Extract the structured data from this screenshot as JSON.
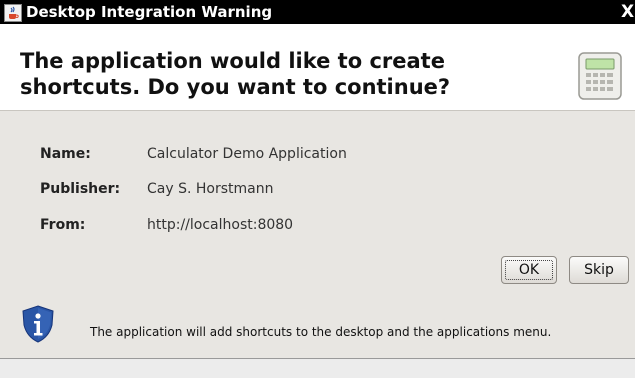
{
  "window": {
    "title": "Desktop Integration Warning",
    "close_glyph": "X"
  },
  "header": {
    "line1": "The application would like to create",
    "line2": "shortcuts. Do you want to continue?",
    "icon": "calculator-icon"
  },
  "details": [
    {
      "label": "Name:",
      "value": "Calculator Demo Application"
    },
    {
      "label": "Publisher:",
      "value": "Cay S. Horstmann"
    },
    {
      "label": "From:",
      "value": "http://localhost:8080"
    }
  ],
  "buttons": {
    "ok": "OK",
    "skip": "Skip"
  },
  "footer": {
    "icon": "info-shield-icon",
    "message": "The application will add shortcuts to the desktop and the applications menu."
  },
  "colors": {
    "title_bar": "#000000",
    "dialog_bg": "#e8e6e2",
    "header_bg": "#ffffff",
    "info_icon": "#2a56a6"
  }
}
